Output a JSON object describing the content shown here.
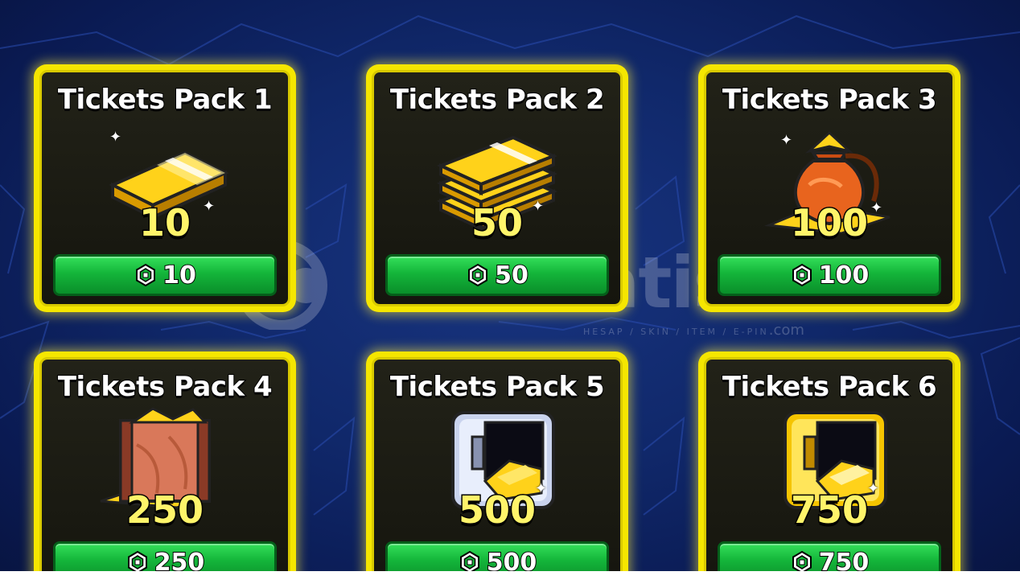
{
  "packs": [
    {
      "title": "Tickets Pack 1",
      "amount": "10",
      "price": "10",
      "art": "ticket-stack-single-icon"
    },
    {
      "title": "Tickets Pack 2",
      "amount": "50",
      "price": "50",
      "art": "ticket-stack-triple-icon"
    },
    {
      "title": "Tickets Pack 3",
      "amount": "100",
      "price": "100",
      "art": "ticket-bag-icon"
    },
    {
      "title": "Tickets Pack 4",
      "amount": "250",
      "price": "250",
      "art": "ticket-crate-icon"
    },
    {
      "title": "Tickets Pack 5",
      "amount": "500",
      "price": "500",
      "art": "silver-safe-icon"
    },
    {
      "title": "Tickets Pack 6",
      "amount": "750",
      "price": "750",
      "art": "gold-safe-icon"
    }
  ],
  "currency_icon": "robux-icon",
  "watermark": {
    "word": "itemsatis",
    "tagline": "HESAP / SKIN / ITEM / E-PIN",
    "suffix": ".com"
  },
  "colors": {
    "background": "#10286a",
    "card_border": "#f5e600",
    "button_green": "#14b53a",
    "amount_yellow": "#fff46a"
  }
}
